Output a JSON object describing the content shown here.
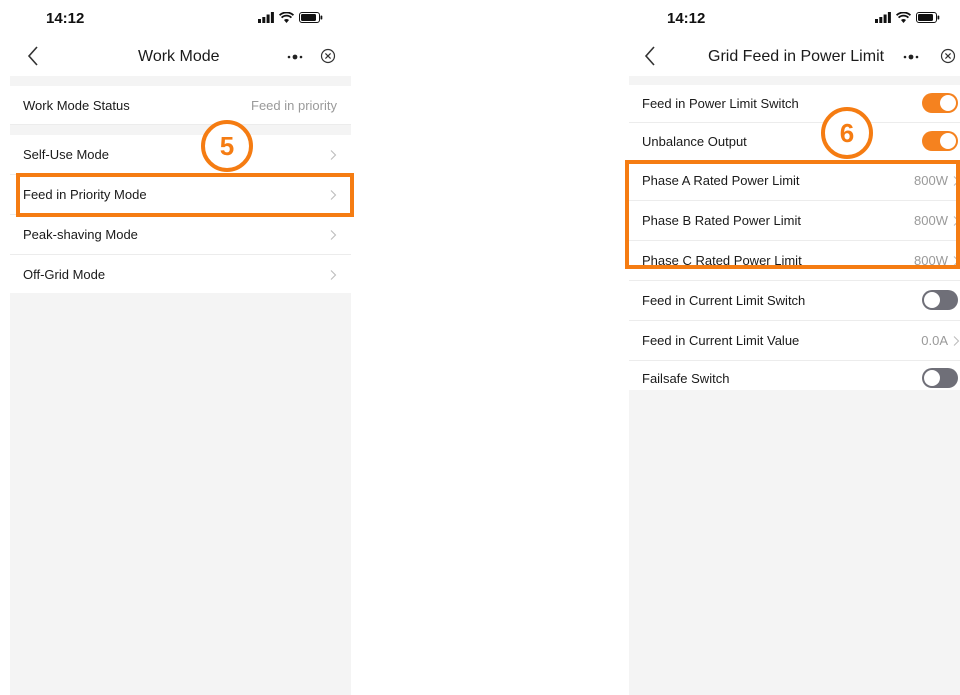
{
  "colors": {
    "accent": "#f57c12",
    "toggle_on": "#f5821f",
    "toggle_off": "#6f6f78",
    "page_bg": "#f4f4f4"
  },
  "left_screen": {
    "status_time": "14:12",
    "title": "Work Mode",
    "status_row": {
      "label": "Work Mode Status",
      "value": "Feed in priority"
    },
    "modes": [
      {
        "label": "Self-Use Mode"
      },
      {
        "label": "Feed in Priority Mode"
      },
      {
        "label": "Peak-shaving Mode"
      },
      {
        "label": "Off-Grid Mode"
      }
    ],
    "step_badge": "5"
  },
  "right_screen": {
    "status_time": "14:12",
    "title": "Grid Feed in Power Limit",
    "rows": [
      {
        "label": "Feed in Power Limit Switch",
        "toggle": true
      },
      {
        "label": "Unbalance Output",
        "toggle": true
      },
      {
        "label": "Phase A Rated Power Limit",
        "value": "800W"
      },
      {
        "label": "Phase B Rated Power Limit",
        "value": "800W"
      },
      {
        "label": "Phase C Rated Power Limit",
        "value": "800W"
      },
      {
        "label": "Feed in Current Limit Switch",
        "toggle": false
      },
      {
        "label": "Feed in Current Limit Value",
        "value": "0.0A"
      },
      {
        "label": "Failsafe Switch",
        "toggle": false
      }
    ],
    "step_badge": "6"
  },
  "icons": [
    "back-chevron-icon",
    "more-dots-icon",
    "close-circle-icon",
    "signal-icon",
    "wifi-icon",
    "battery-icon",
    "chevron-right-icon"
  ]
}
